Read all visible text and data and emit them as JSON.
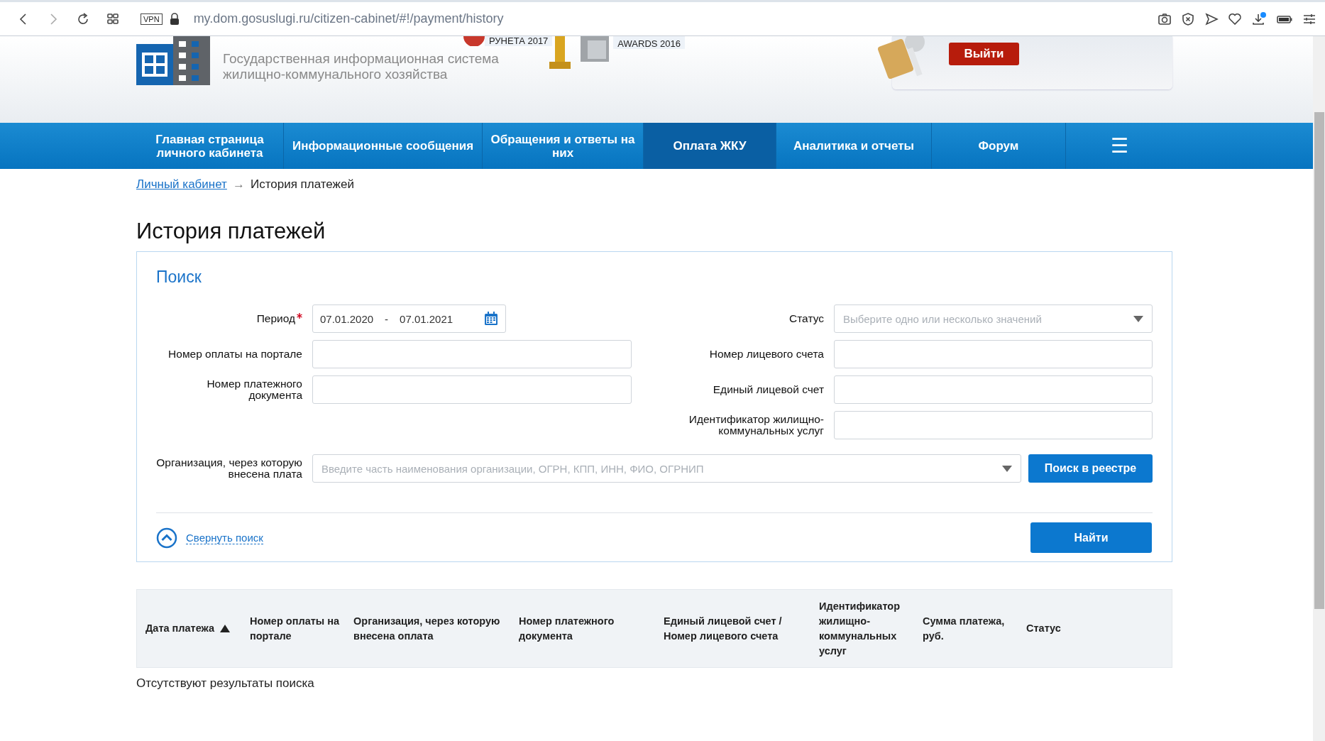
{
  "browser": {
    "vpn": "VPN",
    "url": "my.dom.gosuslugi.ru/citizen-cabinet/#!/payment/history"
  },
  "header": {
    "subtitle": [
      "Государственная информационная система",
      "жилищно-коммунального хозяйства"
    ],
    "awards": [
      "РУНЕТА 2017",
      "AWARDS 2016"
    ],
    "logout": "Выйти"
  },
  "nav": [
    {
      "label": "Главная страница личного кабинета",
      "selected": false
    },
    {
      "label": "Информационные сообщения",
      "selected": false
    },
    {
      "label": "Обращения и ответы на них",
      "selected": false
    },
    {
      "label": "Оплата ЖКУ",
      "selected": true
    },
    {
      "label": "Аналитика и отчеты",
      "selected": false
    },
    {
      "label": "Форум",
      "selected": false
    },
    {
      "label": "☰",
      "selected": false,
      "kind": "menu"
    }
  ],
  "breadcrumb": {
    "link": "Личный кабинет",
    "separator": "→",
    "current": "История платежей"
  },
  "title": "История платежей",
  "search": {
    "heading": "Поиск",
    "left": [
      {
        "label": "Период",
        "required": true,
        "kind": "period",
        "from": "07.01.2020",
        "dash": "-",
        "to": "07.01.2021"
      },
      {
        "label": "Номер оплаты на портале",
        "required": false,
        "kind": "text"
      },
      {
        "label": "Номер платежного документа",
        "required": false,
        "kind": "text"
      }
    ],
    "right": [
      {
        "label": "Статус",
        "required": false,
        "kind": "select",
        "placeholder": "Выберите одно или несколько значений"
      },
      {
        "label": "Номер лицевого счета",
        "required": false,
        "kind": "text"
      },
      {
        "label": "Единый лицевой счет",
        "required": false,
        "kind": "text"
      },
      {
        "label": "Идентификатор жилищно-коммунальных услуг",
        "required": false,
        "kind": "text"
      }
    ],
    "organization": {
      "label": "Организация, через которую внесена плата",
      "placeholder": "Введите часть наименования организации, ОГРН, КПП, ИНН, ФИО, ОГРНИП",
      "button": "Поиск в реестре"
    },
    "collapse": "Свернуть поиск",
    "submit": "Найти"
  },
  "table": {
    "columns": [
      {
        "label": "Дата платежа",
        "sorted": true
      },
      {
        "label": "Номер оплаты на портале",
        "sorted": false
      },
      {
        "label": "Организация, через которую внесена оплата",
        "sorted": false
      },
      {
        "label": "Номер платежного документа",
        "sorted": false
      },
      {
        "label": "Единый лицевой счет / Номер лицевого счета",
        "sorted": false
      },
      {
        "label": "Идентификатор жилищно-коммунальных услуг",
        "sorted": false
      },
      {
        "label": "Сумма платежа, руб.",
        "sorted": false
      },
      {
        "label": "Статус",
        "sorted": false
      }
    ],
    "empty": "Отсутствуют результаты поиска"
  }
}
